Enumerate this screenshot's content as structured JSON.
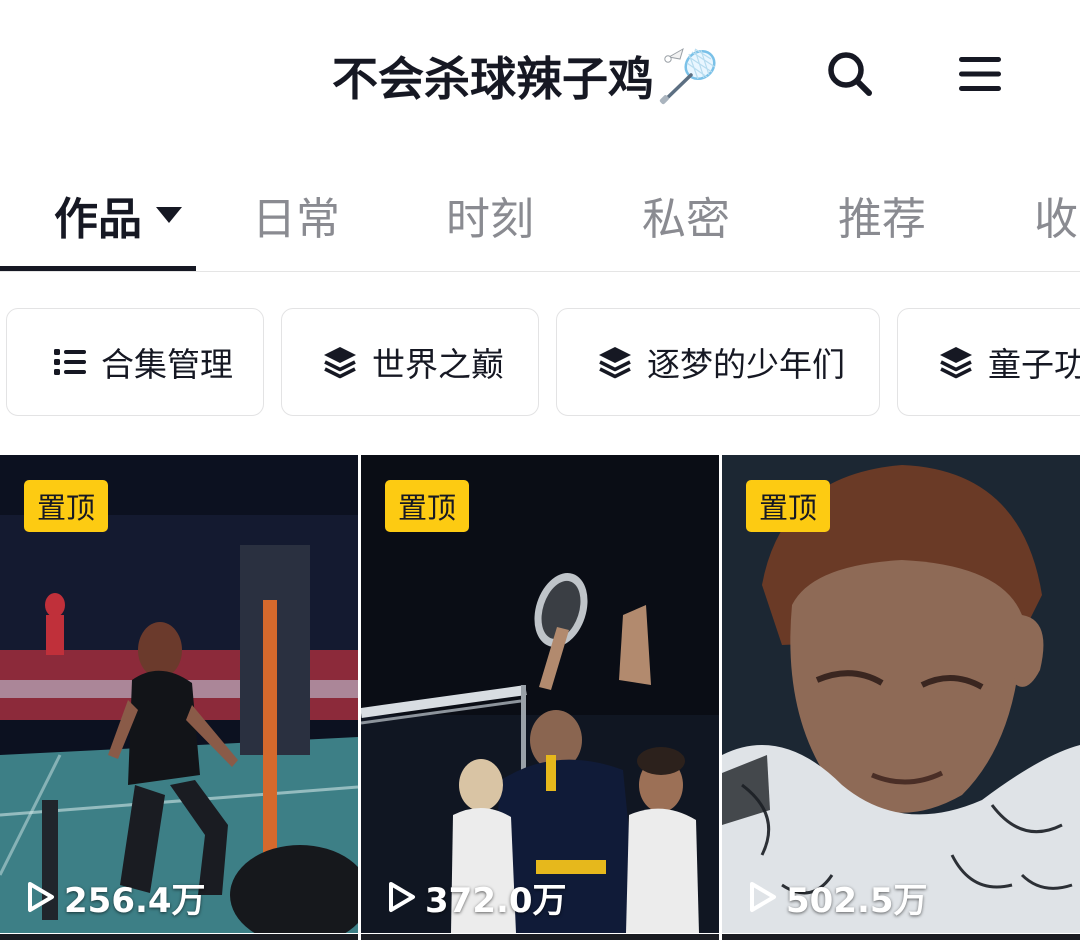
{
  "header": {
    "title": "不会杀球辣子鸡",
    "title_emoji": "badminton-emoji",
    "search_icon": "search-icon",
    "menu_icon": "menu-icon"
  },
  "tabs": [
    {
      "label": "作品",
      "active": true
    },
    {
      "label": "日常",
      "active": false
    },
    {
      "label": "时刻",
      "active": false
    },
    {
      "label": "私密",
      "active": false
    },
    {
      "label": "推荐",
      "active": false
    },
    {
      "label": "收",
      "active": false
    }
  ],
  "collections": [
    {
      "label": "合集管理",
      "icon": "list-icon"
    },
    {
      "label": "世界之巅",
      "icon": "layers-icon"
    },
    {
      "label": "逐梦的少年们",
      "icon": "layers-icon"
    },
    {
      "label": "童子功",
      "icon": "layers-icon"
    }
  ],
  "videos": [
    {
      "pinned_label": "置顶",
      "plays": "256.4万",
      "scene": "badminton player at the net on a blue court"
    },
    {
      "pinned_label": "置顶",
      "plays": "372.0万",
      "scene": "player raising racket beside children"
    },
    {
      "pinned_label": "置顶",
      "plays": "502.5万",
      "scene": "close-up of player with head lowered"
    }
  ],
  "colors": {
    "text_primary": "#161823",
    "text_secondary": "#8a8b91",
    "pin_badge": "#fdcb12",
    "divider": "#e5e5e5"
  }
}
